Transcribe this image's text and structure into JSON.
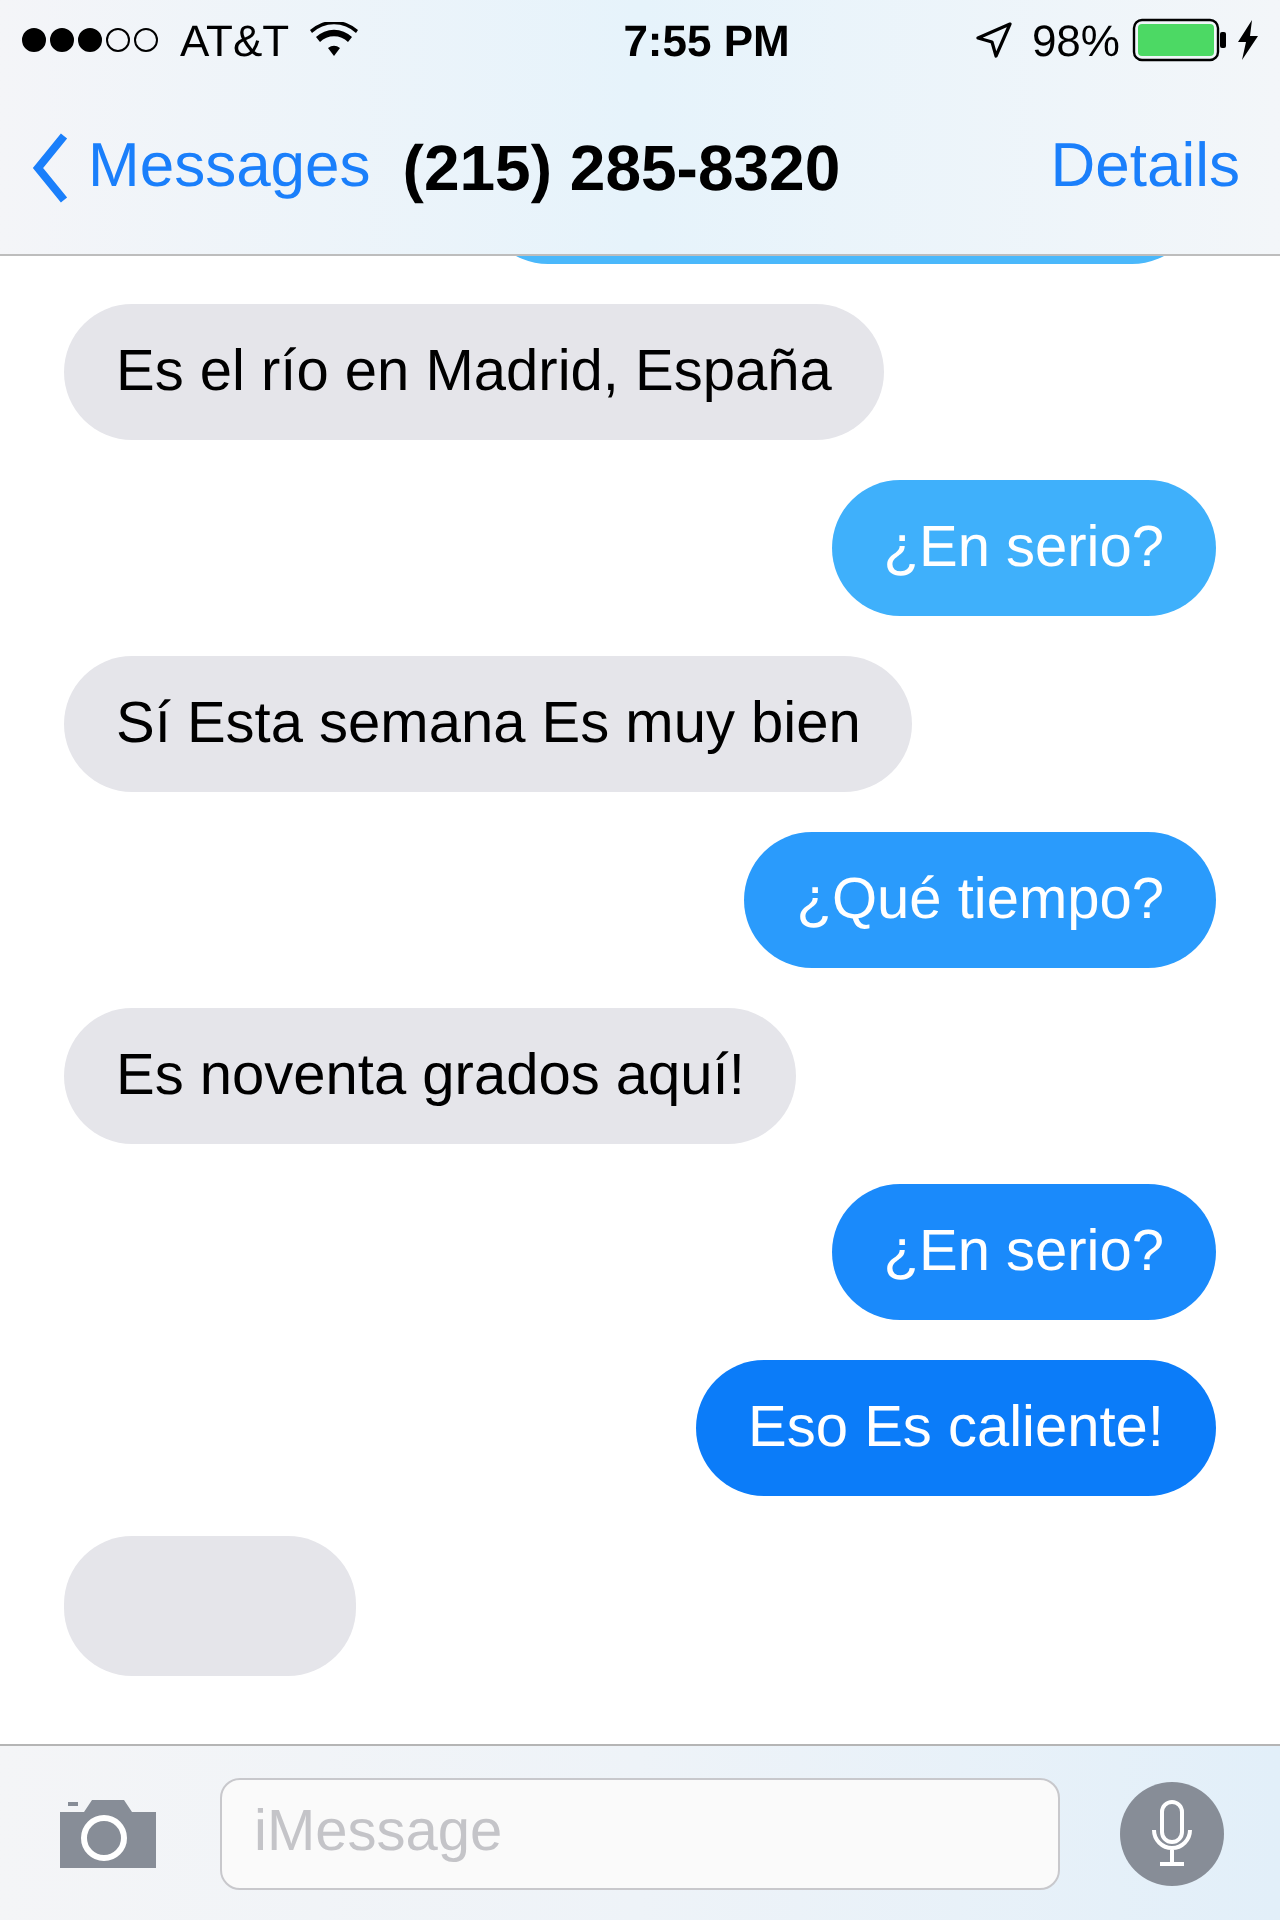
{
  "status_bar": {
    "carrier": "AT&T",
    "time": "7:55 PM",
    "battery": "98%"
  },
  "nav": {
    "back": "Messages",
    "title": "(215) 285-8320",
    "action": "Details"
  },
  "messages": [
    {
      "kind": "incoming",
      "text": "Es el río en Madrid, España"
    },
    {
      "kind": "outgoing",
      "text": "¿En serio?",
      "color": "#3fb0fb"
    },
    {
      "kind": "incoming",
      "text": "Sí Esta semana Es muy bien"
    },
    {
      "kind": "outgoing",
      "text": "¿Qué tiempo?",
      "color": "#2a9bfc"
    },
    {
      "kind": "incoming",
      "text": "Es noventa grados aquí!"
    },
    {
      "kind": "outgoing",
      "text": "¿En serio?",
      "color": "#1a8afb"
    },
    {
      "kind": "outgoing",
      "text": "Eso Es caliente!",
      "color": "#0b7cf9"
    }
  ],
  "composer": {
    "placeholder": "iMessage"
  }
}
